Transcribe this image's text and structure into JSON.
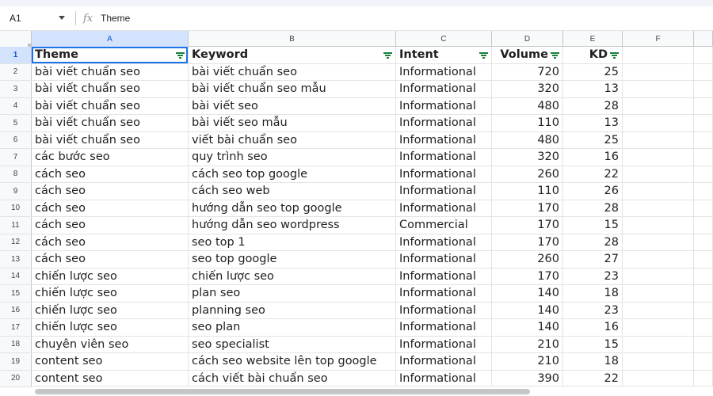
{
  "formula_bar": {
    "cell_ref": "A1",
    "fx_label": "fx",
    "value": "Theme"
  },
  "columns": [
    "A",
    "B",
    "C",
    "D",
    "E",
    "F"
  ],
  "selected_column": "A",
  "header_row": {
    "row_number": "1",
    "theme": "Theme",
    "keyword": "Keyword",
    "intent": "Intent",
    "volume": "Volume",
    "kd": "KD"
  },
  "rows": [
    {
      "n": "2",
      "theme": "bài viết chuẩn seo",
      "keyword": "bài viết chuẩn seo",
      "intent": "Informational",
      "volume": "720",
      "kd": "25"
    },
    {
      "n": "3",
      "theme": "bài viết chuẩn seo",
      "keyword": "bài viết chuẩn seo mẫu",
      "intent": "Informational",
      "volume": "320",
      "kd": "13"
    },
    {
      "n": "4",
      "theme": "bài viết chuẩn seo",
      "keyword": "bài viết seo",
      "intent": "Informational",
      "volume": "480",
      "kd": "28"
    },
    {
      "n": "5",
      "theme": "bài viết chuẩn seo",
      "keyword": "bài viết seo mẫu",
      "intent": "Informational",
      "volume": "110",
      "kd": "13"
    },
    {
      "n": "6",
      "theme": "bài viết chuẩn seo",
      "keyword": "viết bài chuẩn seo",
      "intent": "Informational",
      "volume": "480",
      "kd": "25"
    },
    {
      "n": "7",
      "theme": "các bước seo",
      "keyword": "quy trình seo",
      "intent": "Informational",
      "volume": "320",
      "kd": "16"
    },
    {
      "n": "8",
      "theme": "cách seo",
      "keyword": "cách seo top google",
      "intent": "Informational",
      "volume": "260",
      "kd": "22"
    },
    {
      "n": "9",
      "theme": "cách seo",
      "keyword": "cách seo web",
      "intent": "Informational",
      "volume": "110",
      "kd": "26"
    },
    {
      "n": "10",
      "theme": "cách seo",
      "keyword": "hướng dẫn seo top google",
      "intent": "Informational",
      "volume": "170",
      "kd": "28"
    },
    {
      "n": "11",
      "theme": "cách seo",
      "keyword": "hướng dẫn seo wordpress",
      "intent": "Commercial",
      "volume": "170",
      "kd": "15"
    },
    {
      "n": "12",
      "theme": "cách seo",
      "keyword": "seo top 1",
      "intent": "Informational",
      "volume": "170",
      "kd": "28"
    },
    {
      "n": "13",
      "theme": "cách seo",
      "keyword": "seo top google",
      "intent": "Informational",
      "volume": "260",
      "kd": "27"
    },
    {
      "n": "14",
      "theme": "chiến lược seo",
      "keyword": "chiến lược seo",
      "intent": "Informational",
      "volume": "170",
      "kd": "23"
    },
    {
      "n": "15",
      "theme": "chiến lược seo",
      "keyword": "plan seo",
      "intent": "Informational",
      "volume": "140",
      "kd": "18"
    },
    {
      "n": "16",
      "theme": "chiến lược seo",
      "keyword": "planning seo",
      "intent": "Informational",
      "volume": "140",
      "kd": "23"
    },
    {
      "n": "17",
      "theme": "chiến lược seo",
      "keyword": "seo plan",
      "intent": "Informational",
      "volume": "140",
      "kd": "16"
    },
    {
      "n": "18",
      "theme": "chuyên viên seo",
      "keyword": "seo specialist",
      "intent": "Informational",
      "volume": "210",
      "kd": "15"
    },
    {
      "n": "19",
      "theme": "content seo",
      "keyword": "cách seo website lên top google",
      "intent": "Informational",
      "volume": "210",
      "kd": "18"
    },
    {
      "n": "20",
      "theme": "content seo",
      "keyword": "cách viết bài chuẩn seo",
      "intent": "Informational",
      "volume": "390",
      "kd": "22"
    }
  ],
  "colors": {
    "selection": "#1a73e8",
    "header_selected_bg": "#d3e3fd",
    "filter_icon": "#188038"
  }
}
